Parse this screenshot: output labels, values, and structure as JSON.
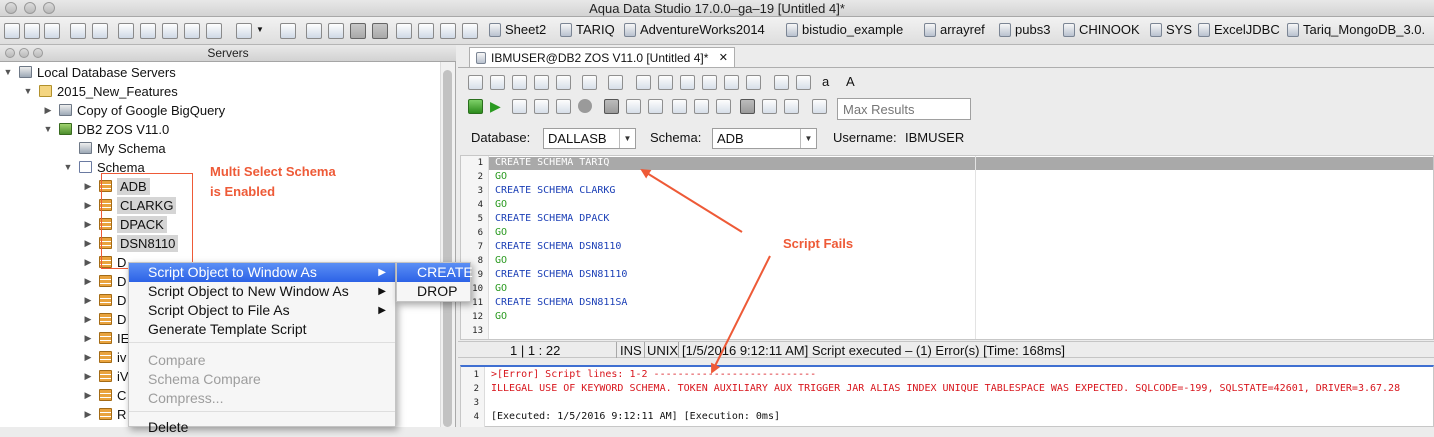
{
  "window": {
    "title": "Aqua Data Studio 17.0.0–ga–19 [Untitled 4]*"
  },
  "connections": [
    {
      "label": "Sheet2"
    },
    {
      "label": "TARIQ"
    },
    {
      "label": "AdventureWorks2014"
    },
    {
      "label": "bistudio_example"
    },
    {
      "label": "arrayref"
    },
    {
      "label": "pubs3"
    },
    {
      "label": "CHINOOK"
    },
    {
      "label": "SYS"
    },
    {
      "label": "ExcelJDBC"
    },
    {
      "label": "Tariq_MongoDB_3.0."
    }
  ],
  "servers": {
    "title": "Servers",
    "tree": {
      "root": "Local Database Servers",
      "folder": "2015_New_Features",
      "items": {
        "bigquery": "Copy of Google BigQuery",
        "db2": "DB2 ZOS V11.0",
        "my_schema": "My Schema",
        "schema": "Schema"
      },
      "schemas": [
        "ADB",
        "CLARKG",
        "DPACK",
        "DSN8110",
        "D",
        "D",
        "D",
        "D",
        "IE",
        "iv",
        "iV",
        "C",
        "R"
      ]
    }
  },
  "annotations": {
    "multi_select": "Multi Select Schema\nis Enabled",
    "multi_select_l1": "Multi Select Schema",
    "multi_select_l2": "is Enabled",
    "script_fails": "Script Fails"
  },
  "context_menu": {
    "items": [
      {
        "label": "Script Object to Window As",
        "has_submenu": true,
        "highlighted": true
      },
      {
        "label": "Script Object to New Window As",
        "has_submenu": true
      },
      {
        "label": "Script Object to File As",
        "has_submenu": true
      },
      {
        "label": "Generate Template Script"
      },
      {
        "label": "Compare",
        "disabled": true
      },
      {
        "label": "Schema Compare",
        "disabled": true
      },
      {
        "label": "Compress...",
        "disabled": true
      },
      {
        "label": "Delete"
      }
    ],
    "submenu": [
      {
        "label": "CREATE",
        "highlighted": true
      },
      {
        "label": "DROP"
      }
    ],
    "submenu_arrow": "▶"
  },
  "editor": {
    "tab_title": "IBMUSER@DB2 ZOS V11.0 [Untitled 4]*",
    "tab_close": "✕",
    "max_results_placeholder": "Max Results",
    "font_up": "a",
    "font_down": "A",
    "database_label": "Database:",
    "database_value": "DALLASB",
    "schema_label": "Schema:",
    "schema_value": "ADB",
    "username_label": "Username:",
    "username_value": "IBMUSER",
    "code_lines": [
      {
        "num": "1",
        "text": "CREATE SCHEMA TARIQ"
      },
      {
        "num": "2",
        "text": "GO"
      },
      {
        "num": "3",
        "text": "CREATE SCHEMA CLARKG"
      },
      {
        "num": "4",
        "text": "GO"
      },
      {
        "num": "5",
        "text": "CREATE SCHEMA DPACK"
      },
      {
        "num": "6",
        "text": "GO"
      },
      {
        "num": "7",
        "text": "CREATE SCHEMA DSN8110"
      },
      {
        "num": "8",
        "text": "GO"
      },
      {
        "num": "9",
        "text": "CREATE SCHEMA DSN81110"
      },
      {
        "num": "10",
        "text": "GO"
      },
      {
        "num": "11",
        "text": "CREATE SCHEMA DSN811SA"
      },
      {
        "num": "12",
        "text": "GO"
      },
      {
        "num": "13",
        "text": ""
      }
    ],
    "status": {
      "position": "1 | 1 : 22",
      "ins": "INS",
      "unix": "UNIX",
      "message": "[1/5/2016 9:12:11 AM] Script executed – (1) Error(s) [Time: 168ms]"
    },
    "output_lines": [
      {
        "num": "1",
        "text": ">[Error] Script lines: 1-2 ---------------------------"
      },
      {
        "num": "2",
        "text": " ILLEGAL USE OF KEYWORD SCHEMA.  TOKEN AUXILIARY AUX TRIGGER JAR ALIAS INDEX UNIQUE TABLESPACE WAS EXPECTED. SQLCODE=-199, SQLSTATE=42601, DRIVER=3.67.28"
      },
      {
        "num": "3",
        "text": ""
      },
      {
        "num": "4",
        "text": " [Executed: 1/5/2016 9:12:11 AM] [Execution: 0ms]"
      }
    ]
  },
  "colors": {
    "annotation": "#ee5a37",
    "keyword": "#1b3fb6",
    "go": "#2a9a20",
    "error": "#d8161d",
    "highlight": "#2c62e6"
  }
}
